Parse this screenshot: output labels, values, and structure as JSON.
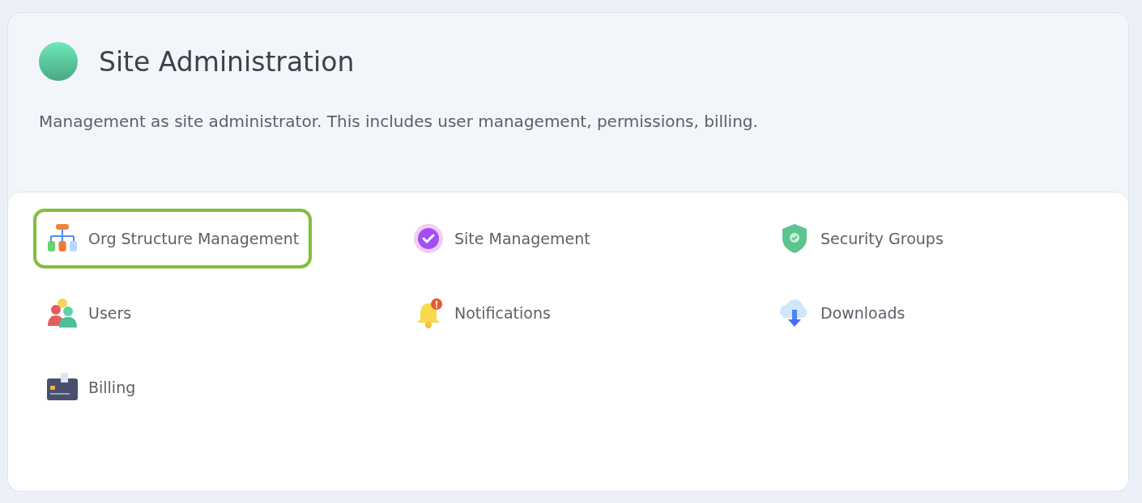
{
  "header": {
    "title": "Site Administration",
    "description": "Management as site administrator. This includes user management, permissions, billing."
  },
  "items": [
    {
      "label": "Org Structure Management",
      "selected": true
    },
    {
      "label": "Site Management",
      "selected": false
    },
    {
      "label": "Security Groups",
      "selected": false
    },
    {
      "label": "Users",
      "selected": false
    },
    {
      "label": "Notifications",
      "selected": false
    },
    {
      "label": "Downloads",
      "selected": false
    },
    {
      "label": "Billing",
      "selected": false
    }
  ]
}
